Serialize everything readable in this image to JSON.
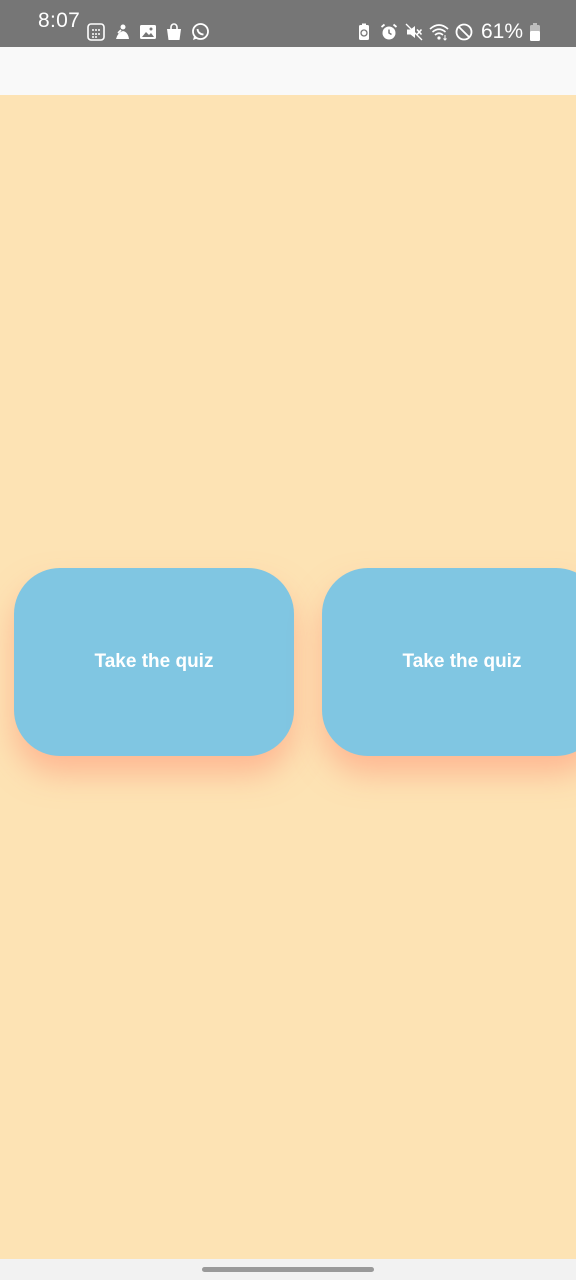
{
  "status_bar": {
    "time": "8:07",
    "battery_percent": "61%",
    "left_icons": [
      "calculator-icon",
      "game-icon",
      "gallery-icon",
      "shopping-bag-icon",
      "whatsapp-icon"
    ],
    "right_icons": [
      "battery-saver-icon",
      "alarm-icon",
      "mute-icon",
      "wifi-icon",
      "do-not-disturb-icon",
      "battery-icon"
    ]
  },
  "cards": [
    {
      "label": "Take the quiz"
    },
    {
      "label": "Take the quiz"
    }
  ],
  "colors": {
    "background": "#fde3b4",
    "card": "#80c6e2",
    "card_text": "#ffffff",
    "status_bar": "#767676",
    "app_bar": "#f9f9f9"
  }
}
